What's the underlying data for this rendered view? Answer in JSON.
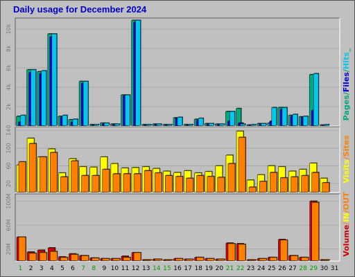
{
  "title": "Daily usage for December 2024",
  "colors": {
    "pages": "#00a880",
    "files": "#0000d8",
    "hits": "#00c8f0",
    "visits": "#ffff00",
    "sites": "#ff8000",
    "in": "#ff8000",
    "out": "#ffff00",
    "volume": "#d00000",
    "weekend": "#00a000",
    "weekday": "#000000",
    "panel_bg": "#c0c0c0"
  },
  "chart_data": [
    {
      "type": "bar",
      "ylabel": "Pages / Files / Hits",
      "ylabel_parts": [
        {
          "text": "Pages",
          "color": "#00a880"
        },
        {
          "text": "/",
          "color": "#00a880"
        },
        {
          "text": "Files",
          "color": "#0000d8"
        },
        {
          "text": "/",
          "color": "#00a880"
        },
        {
          "text": "Hits",
          "color": "#00c8f0"
        },
        {
          "text": "_",
          "color": "#00a880"
        }
      ],
      "yticks": [
        {
          "value": 2000,
          "label": "2k"
        },
        {
          "value": 4000,
          "label": "4k"
        },
        {
          "value": 6000,
          "label": "6k"
        },
        {
          "value": 8000,
          "label": "8k"
        },
        {
          "value": 10000,
          "label": "10k"
        }
      ],
      "ylim": [
        0,
        11000
      ],
      "series": [
        {
          "name": "Hits",
          "values": [
            1100,
            5800,
            5700,
            9500,
            1100,
            700,
            4600,
            150,
            300,
            200,
            3200,
            10900,
            150,
            200,
            150,
            900,
            150,
            800,
            250,
            200,
            1500,
            200,
            150,
            250,
            1900,
            1900,
            1200,
            1000,
            5400,
            150,
            0
          ]
        },
        {
          "name": "Files",
          "values": [
            400,
            5500,
            5400,
            9200,
            900,
            400,
            4400,
            100,
            200,
            150,
            3100,
            10700,
            100,
            150,
            100,
            800,
            100,
            600,
            200,
            150,
            500,
            300,
            100,
            200,
            500,
            1700,
            1000,
            900,
            1600,
            100,
            0
          ]
        },
        {
          "name": "Pages",
          "values": [
            1000,
            5800,
            5600,
            9500,
            1000,
            650,
            4600,
            150,
            300,
            200,
            3200,
            10900,
            150,
            200,
            150,
            850,
            150,
            700,
            250,
            200,
            1500,
            1800,
            100,
            250,
            300,
            1900,
            1100,
            950,
            5300,
            100,
            0
          ]
        }
      ]
    },
    {
      "type": "bar",
      "ylabel": "Visits / Sites",
      "ylabel_parts": [
        {
          "text": "Visits",
          "color": "#ffff00"
        },
        {
          "text": "/",
          "color": "#ff8000"
        },
        {
          "text": "Sites",
          "color": "#ff8000"
        }
      ],
      "yticks": [
        {
          "value": 20,
          "label": "20"
        },
        {
          "value": 60,
          "label": "60"
        },
        {
          "value": 100,
          "label": "100"
        },
        {
          "value": 140,
          "label": "140"
        }
      ],
      "ylim": [
        0,
        145
      ],
      "series": [
        {
          "name": "Visits",
          "values": [
            62,
            122,
            80,
            98,
            44,
            76,
            58,
            57,
            80,
            65,
            55,
            56,
            58,
            54,
            48,
            45,
            49,
            44,
            47,
            60,
            84,
            138,
            28,
            40,
            60,
            58,
            48,
            52,
            66,
            32,
            0
          ]
        },
        {
          "name": "Sites",
          "values": [
            69,
            110,
            80,
            90,
            35,
            71,
            38,
            38,
            52,
            42,
            42,
            42,
            49,
            44,
            38,
            36,
            32,
            38,
            36,
            34,
            65,
            124,
            12,
            25,
            45,
            33,
            35,
            38,
            45,
            22,
            0
          ]
        }
      ]
    },
    {
      "type": "bar",
      "ylabel": "Volume / IN / OUT",
      "ylabel_parts": [
        {
          "text": "Volume",
          "color": "#d00000"
        },
        {
          "text": "/",
          "color": "#ff8000"
        },
        {
          "text": "IN",
          "color": "#ffff00"
        },
        {
          "text": "/",
          "color": "#ff8000"
        },
        {
          "text": "OUT",
          "color": "#ff8000"
        }
      ],
      "yticks": [
        {
          "value": 20,
          "label": "20M"
        },
        {
          "value": 60,
          "label": "60M"
        },
        {
          "value": 100,
          "label": "100M"
        }
      ],
      "ylim": [
        0,
        110
      ],
      "series": [
        {
          "name": "Volume",
          "values": [
            40,
            15,
            18,
            22,
            7,
            12,
            9,
            5,
            4,
            4,
            8,
            14,
            2,
            3,
            2,
            4,
            3,
            6,
            4,
            3,
            30,
            29,
            2,
            4,
            6,
            36,
            9,
            6,
            100,
            2,
            0
          ]
        },
        {
          "name": "OUT",
          "values": [
            40,
            13,
            14,
            16,
            6,
            11,
            9,
            5,
            4,
            4,
            6,
            14,
            2,
            3,
            2,
            4,
            3,
            6,
            4,
            3,
            29,
            28,
            2,
            4,
            6,
            35,
            9,
            6,
            98,
            2,
            0
          ]
        }
      ]
    }
  ],
  "days": [
    {
      "label": "1",
      "weekend": true
    },
    {
      "label": "2",
      "weekend": false
    },
    {
      "label": "3",
      "weekend": false
    },
    {
      "label": "4",
      "weekend": false
    },
    {
      "label": "5",
      "weekend": false
    },
    {
      "label": "6",
      "weekend": false
    },
    {
      "label": "7",
      "weekend": true
    },
    {
      "label": "8",
      "weekend": true
    },
    {
      "label": "9",
      "weekend": false
    },
    {
      "label": "10",
      "weekend": false
    },
    {
      "label": "11",
      "weekend": false
    },
    {
      "label": "12",
      "weekend": false
    },
    {
      "label": "13",
      "weekend": false
    },
    {
      "label": "14",
      "weekend": true
    },
    {
      "label": "15",
      "weekend": true
    },
    {
      "label": "16",
      "weekend": false
    },
    {
      "label": "17",
      "weekend": false
    },
    {
      "label": "18",
      "weekend": false
    },
    {
      "label": "19",
      "weekend": false
    },
    {
      "label": "20",
      "weekend": false
    },
    {
      "label": "21",
      "weekend": true
    },
    {
      "label": "22",
      "weekend": true
    },
    {
      "label": "23",
      "weekend": false
    },
    {
      "label": "24",
      "weekend": false
    },
    {
      "label": "25",
      "weekend": false
    },
    {
      "label": "26",
      "weekend": false
    },
    {
      "label": "27",
      "weekend": false
    },
    {
      "label": "28",
      "weekend": true
    },
    {
      "label": "29",
      "weekend": true
    },
    {
      "label": "30",
      "weekend": false
    },
    {
      "label": "31",
      "weekend": false
    }
  ]
}
